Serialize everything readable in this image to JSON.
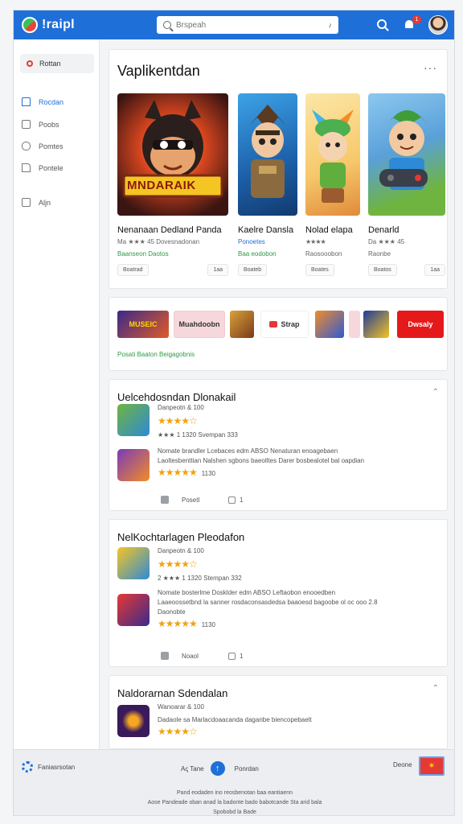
{
  "topbar": {
    "app_name": "!raipl",
    "search_placeholder": "Brspeah",
    "search_mic": "♪",
    "notification_count": "1"
  },
  "sidebar": {
    "top_item": "Rottan",
    "items": [
      {
        "label": "Rocdan",
        "active": true
      },
      {
        "label": "Poobs",
        "active": false
      },
      {
        "label": "Pomtes",
        "active": false
      },
      {
        "label": "Pontele",
        "active": false
      },
      {
        "label": "Aljn",
        "active": false
      }
    ]
  },
  "hero": {
    "title": "Vaplikentdan",
    "more": "···",
    "games": [
      {
        "name": "Nenanaan Dedland Panda",
        "meta": "Ma ★★★ 45 Dovesnadonan",
        "sub": "Baanseon Daotos",
        "btn1": "Boatrad",
        "btn2": "1aa",
        "thumb_text": "MNDARAIK"
      },
      {
        "name": "Kaelre Dansla",
        "meta": "Ponoetes",
        "sub": "Baa eodobon",
        "btn1": "Boateb"
      },
      {
        "name": "Nolad elapa",
        "meta": "★★★★",
        "sub": "Raosooobon",
        "btn1": "Boates"
      },
      {
        "name": "Denarld",
        "meta": "Da ★★★ 45",
        "sub": "Raonbe",
        "btn1": "Boatos",
        "btn2": "1aa"
      }
    ]
  },
  "strip": {
    "chips": [
      "MUSEIC",
      "Muahdoobn",
      "",
      "Strap",
      "",
      "",
      "Dwsaly"
    ],
    "link": "Posati Baaton Beigagobnis"
  },
  "lists": [
    {
      "title": "Uelcehdosndan Dlonakail",
      "rows": [
        {
          "line1": "Danpeotn & 100",
          "stars": "★★★★☆",
          "count": ""
        },
        {
          "line1": "★★★ 1 1320  Svempan 333",
          "stars": "",
          "count": ""
        },
        {
          "line1": "Nomate brandler Lcebaces edm ABSO Nenaturan enoagebaen",
          "line2": "Laoltesbenttian Nalshen sgbons baeolltes Darer bosbealotel bal oapdian",
          "stars": "★★★★★",
          "count": "1130"
        }
      ],
      "like_label": "Posetl",
      "share_label": "1"
    },
    {
      "title": "NelKochtarlagen Pleodafon",
      "rows": [
        {
          "line1": "Danpeotn & 100",
          "stars": "★★★★☆",
          "count": ""
        },
        {
          "line1": "2 ★★★ 1 1320  Stempan 332",
          "stars": "",
          "count": ""
        },
        {
          "line1": "Nomate bosterlme Dosklder edm ABSO Leftaobon enooedben",
          "line2": "Laaeoossetbnd la sanner rosdaconsasdedsa baaoesd bagoobe ol oc ooo 2.8",
          "line3": "Daonobte",
          "stars": "★★★★★",
          "count": "1130"
        }
      ],
      "like_label": "Noaol",
      "share_label": "1"
    },
    {
      "title": "Naldorarnan Sdendalan",
      "rows": [
        {
          "line1": "Wanoarar & 100",
          "stars": "",
          "count": ""
        },
        {
          "line1": "Dadaole sa Marlacdoaacanda daganbe biencopebaelt",
          "stars": "★★★★☆",
          "count": ""
        }
      ]
    }
  ],
  "bottom": {
    "left_label": "Faniasrsotan",
    "mid_label": "Aꞔ Tane",
    "right_mid_label": "Ponrdan",
    "right_label": "Deone",
    "flag_symbol": "✶",
    "footer_lines": [
      "Pand eodaden ino reosbenotan baa eantiaenn",
      "Aose Pandeade oban anad la badonte bado babotcande Sta arid bala",
      "Spobobd la Bade"
    ]
  }
}
